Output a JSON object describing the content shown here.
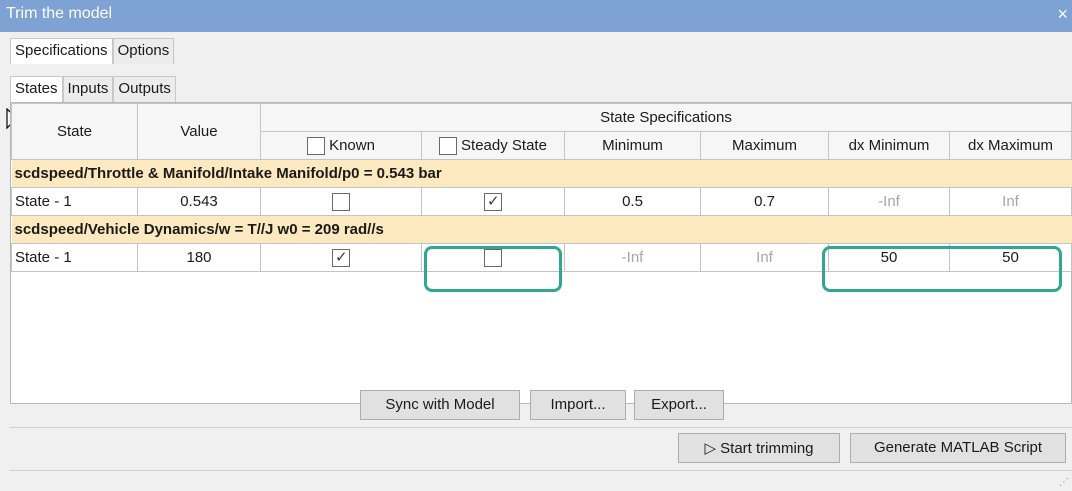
{
  "window": {
    "title": "Trim the model",
    "close_glyph": "×"
  },
  "outer_tabs": [
    "Specifications",
    "Options"
  ],
  "inner_tabs": [
    "States",
    "Inputs",
    "Outputs"
  ],
  "table": {
    "col_state": "State",
    "col_value": "Value",
    "group_header": "State Specifications",
    "col_known": "Known",
    "col_steady": "Steady State",
    "col_min": "Minimum",
    "col_max": "Maximum",
    "col_dxmin": "dx Minimum",
    "col_dxmax": "dx Maximum",
    "groups": [
      {
        "name": "scdspeed/Throttle & Manifold/Intake Manifold/p0 = 0.543 bar",
        "row": {
          "state": "State - 1",
          "value": "0.543",
          "known": false,
          "steady": true,
          "min": "0.5",
          "max": "0.7",
          "dxmin": "-Inf",
          "dxmax": "Inf"
        }
      },
      {
        "name": "scdspeed/Vehicle Dynamics/w = T//J w0 = 209 rad//s",
        "row": {
          "state": "State - 1",
          "value": "180",
          "known": true,
          "steady": false,
          "min": "-Inf",
          "max": "Inf",
          "dxmin": "50",
          "dxmax": "50"
        }
      }
    ]
  },
  "buttons": {
    "sync": "Sync with Model",
    "import": "Import...",
    "export": "Export...",
    "start": "▷ Start trimming",
    "generate": "Generate MATLAB Script"
  },
  "colors": {
    "title_bar": "#7da2d3",
    "group_row": "#fde9bf",
    "highlight": "#2fa88e"
  }
}
